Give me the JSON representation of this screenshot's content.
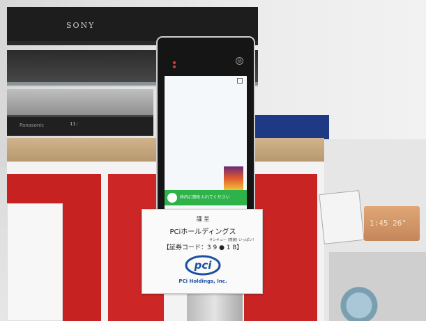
{
  "tv": {
    "brand": "SONY"
  },
  "recorder": {
    "brand": "Panasonic",
    "display": "11:"
  },
  "screen": {
    "bar_text": "枠内に顔を入れてください"
  },
  "sign": {
    "line1": "謹 呈",
    "line2": "PCiホールディングス",
    "small": "サンキュー (感謝) いっぱい!",
    "line3": "【証券コード：3 9 ● 1 8】",
    "logo_text": "PCi Holdings, Inc.",
    "logo_color": "#1b4fa0"
  },
  "clock": {
    "display": "1:45 26°"
  }
}
